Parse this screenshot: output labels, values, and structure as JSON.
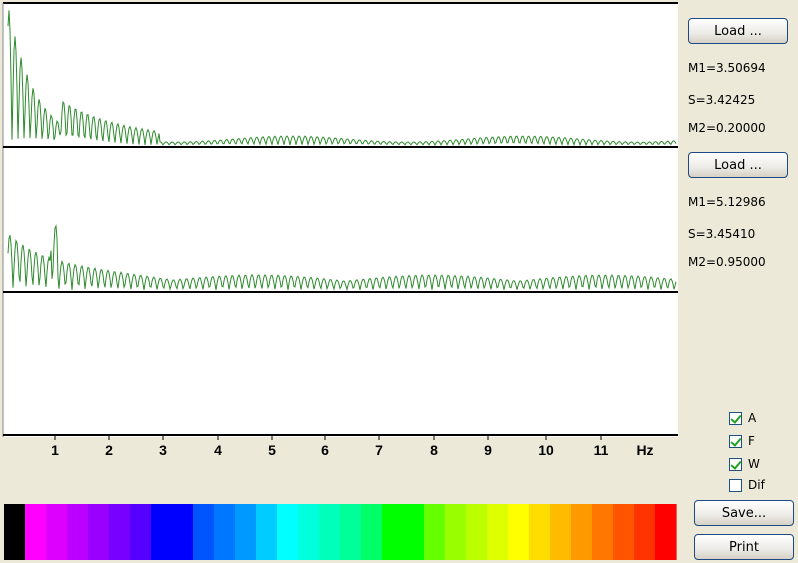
{
  "panels": [
    {
      "load_label": "Load ...",
      "m1": "M1=3.50694",
      "s": "S=3.42425",
      "m2": "M2=0.20000"
    },
    {
      "load_label": "Load ...",
      "m1": "M1=5.12986",
      "s": "S=3.45410",
      "m2": "M2=0.95000"
    }
  ],
  "axis": {
    "ticks": [
      "1",
      "2",
      "3",
      "4",
      "5",
      "6",
      "7",
      "8",
      "9",
      "10",
      "11"
    ],
    "unit": "Hz"
  },
  "options": [
    {
      "label": "A",
      "checked": true
    },
    {
      "label": "F",
      "checked": true
    },
    {
      "label": "W",
      "checked": true
    },
    {
      "label": "Dif",
      "checked": false
    }
  ],
  "buttons": {
    "save_label": "Save...",
    "print_label": "Print"
  },
  "colors": {
    "spectrum_line": "#2e8b2e",
    "plot_bg": "#ffffff",
    "window_bg": "#ece9d8",
    "palette": [
      "#000000",
      "#ff00ff",
      "#dd00ff",
      "#bb00ff",
      "#9900ff",
      "#7700ff",
      "#5500ff",
      "#0000ff",
      "#0000ff",
      "#0055ff",
      "#0077ff",
      "#0099ff",
      "#00ccff",
      "#00ffff",
      "#00ffdd",
      "#00ffbb",
      "#00ff99",
      "#00ff66",
      "#00ff00",
      "#00ff00",
      "#66ff00",
      "#99ff00",
      "#bbff00",
      "#ddff00",
      "#ffff00",
      "#ffdd00",
      "#ffbb00",
      "#ff9900",
      "#ff7700",
      "#ff5500",
      "#ff3300",
      "#ff0000"
    ]
  }
}
